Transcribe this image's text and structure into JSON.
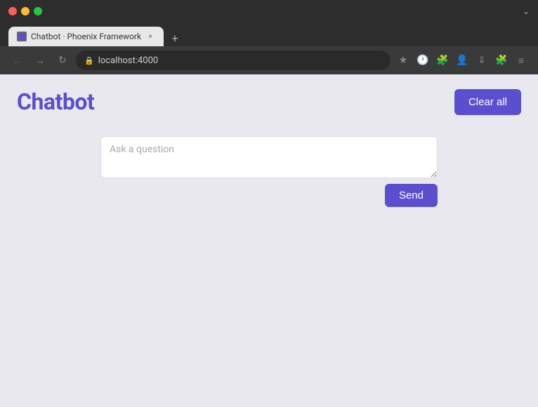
{
  "browser": {
    "tab_title": "Chatbot · Phoenix Framework",
    "address": "localhost:4000",
    "new_tab_label": "+",
    "tab_close_label": "×"
  },
  "page": {
    "title": "Chatbot",
    "clear_all_label": "Clear all",
    "send_label": "Send",
    "question_placeholder": "Ask a question"
  },
  "colors": {
    "accent": "#5b4fcf",
    "accent_hover": "#4a3fb8",
    "page_bg": "#e8e8ee"
  }
}
